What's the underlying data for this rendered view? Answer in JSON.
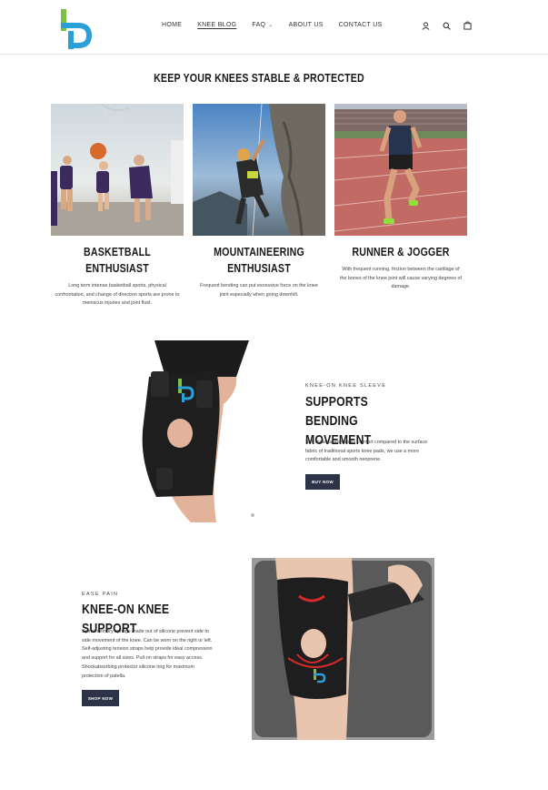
{
  "header": {
    "nav": [
      {
        "label": "HOME",
        "active": false
      },
      {
        "label": "KNEE BLOG",
        "active": true
      },
      {
        "label": "FAQ",
        "active": false,
        "has_dropdown": true
      },
      {
        "label": "ABOUT US",
        "active": false
      },
      {
        "label": "CONTACT US",
        "active": false
      }
    ],
    "icons": [
      "user-icon",
      "search-icon",
      "cart-icon"
    ],
    "logo_colors": {
      "green": "#7cc242",
      "blue": "#2a9fd8"
    }
  },
  "section_title": "KEEP YOUR KNEES STABLE & PROTECTED",
  "cards": [
    {
      "title": "BASKETBALL ENTHUSIAST",
      "text": "Long term intense basketball sports, physical confrontation, and change of direction sports are prone to meniscus injuries and joint fluid."
    },
    {
      "title": "MOUNTAINEERING ENTHUSIAST",
      "text": "Frequent bending can put excessive force on the knee joint especially when going downhill."
    },
    {
      "title": "RUNNER & JOGGER",
      "text": "With frequent running, friction between the cartilage of the bones of the knee joint will cause varying degrees of damage."
    }
  ],
  "feature1": {
    "eyebrow": "KNEE-ON KNEE SLEEVE",
    "title": "SUPPORTS BENDING MOVEMENT",
    "text": "Soft material enhances comfort compared to the surface fabric of traditional sports knee pads, we use a more comfortable and smooth neoprene.",
    "button": "BUY NOW"
  },
  "feature2": {
    "eyebrow": "EASE PAIN",
    "title": "KNEE-ON KNEE SUPPORT",
    "text": "Spiral memory springs made out of silicone prevent side to side movement of the knee. Can be worn on the right or left. Self-adjusting tension straps help provide ideal compression and support for all sizes. Pull-on straps for easy access. Shockabsorbing protector silicone ring for maximum protection of patella.",
    "button": "SHOP NOW"
  },
  "colors": {
    "button_bg": "#2e3448",
    "accent_red": "#d42a2a"
  }
}
